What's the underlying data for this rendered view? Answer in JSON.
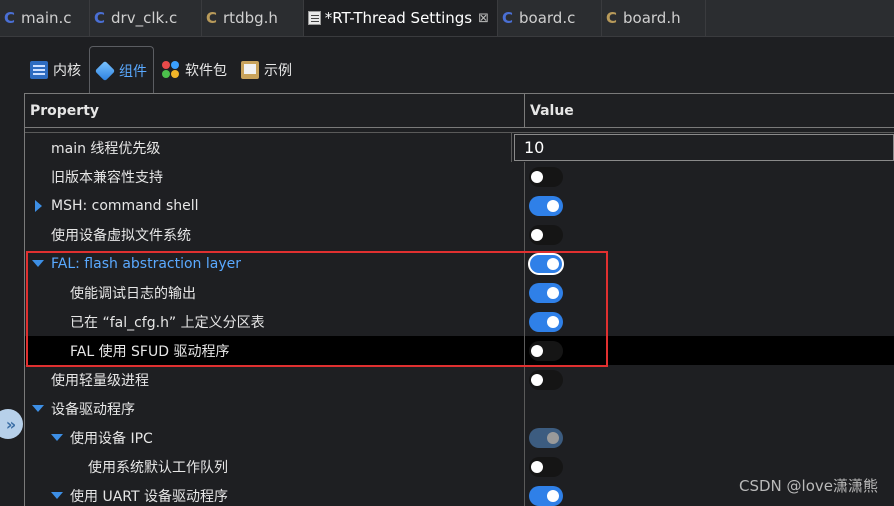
{
  "editor_tabs": [
    {
      "label": "main.c",
      "icon": "c-file-icon",
      "active": false
    },
    {
      "label": "drv_clk.c",
      "icon": "c-file-icon",
      "active": false
    },
    {
      "label": "rtdbg.h",
      "icon": "h-file-icon",
      "active": false
    },
    {
      "label": "*RT-Thread Settings",
      "icon": "settings-file-icon",
      "active": true,
      "close": "⊠"
    },
    {
      "label": "board.c",
      "icon": "c-file-icon",
      "active": false
    },
    {
      "label": "board.h",
      "icon": "h-file-icon",
      "active": false
    }
  ],
  "section_tabs": [
    {
      "label": "内核",
      "icon": "kernel-icon",
      "active": false
    },
    {
      "label": "组件",
      "icon": "component-icon",
      "active": true
    },
    {
      "label": "软件包",
      "icon": "packages-icon",
      "active": false
    },
    {
      "label": "示例",
      "icon": "sample-icon",
      "active": false
    }
  ],
  "table": {
    "headers": {
      "property": "Property",
      "value": "Value"
    },
    "rows": [
      {
        "label": "main 线程优先级",
        "value": "10"
      },
      {
        "label": "旧版本兼容性支持",
        "toggle": "off"
      },
      {
        "label": "MSH: command shell",
        "toggle": "on",
        "expander": "collapsed"
      },
      {
        "label": "使用设备虚拟文件系统",
        "toggle": "off"
      },
      {
        "label": "FAL: flash abstraction layer",
        "toggle": "on",
        "expander": "expanded",
        "focused": true
      },
      {
        "label": "使能调试日志的输出",
        "toggle": "on"
      },
      {
        "label": "已在 “fal_cfg.h” 上定义分区表",
        "toggle": "on"
      },
      {
        "label": "FAL 使用 SFUD 驱动程序",
        "toggle": "off",
        "selected": true
      },
      {
        "label": "使用轻量级进程",
        "toggle": "off"
      },
      {
        "label": "设备驱动程序",
        "expander": "expanded"
      },
      {
        "label": "使用设备 IPC",
        "toggle": "disabled",
        "expander": "expanded"
      },
      {
        "label": "使用系统默认工作队列",
        "toggle": "off"
      },
      {
        "label": "使用 UART 设备驱动程序",
        "toggle": "on",
        "expander": "expanded"
      }
    ]
  },
  "colors": {
    "accent": "#2f80e8",
    "highlight_box": "#e03030",
    "background": "#1e1f22"
  },
  "expand_handle_glyph": "»",
  "watermark": "CSDN @love潇潇熊"
}
